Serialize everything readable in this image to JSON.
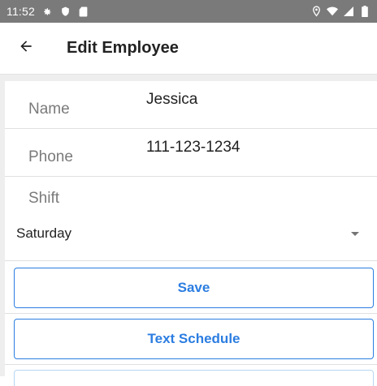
{
  "status_bar": {
    "time": "11:52",
    "left_icons": [
      "gear-icon",
      "shield-icon",
      "sd-card-icon"
    ],
    "right_icons": [
      "location-icon",
      "wifi-icon",
      "signal-icon",
      "battery-icon"
    ]
  },
  "app_bar": {
    "title": "Edit Employee",
    "back_icon": "arrow-left-icon"
  },
  "form": {
    "name": {
      "label": "Name",
      "value": "Jessica"
    },
    "phone": {
      "label": "Phone",
      "value": "111-123-1234"
    },
    "shift": {
      "label": "Shift",
      "selected": "Saturday"
    }
  },
  "buttons": {
    "save": "Save",
    "text_schedule": "Text Schedule"
  },
  "colors": {
    "status_bar": "#7a7a7a",
    "accent": "#2b7de1",
    "content_bg": "#eeeeee"
  }
}
